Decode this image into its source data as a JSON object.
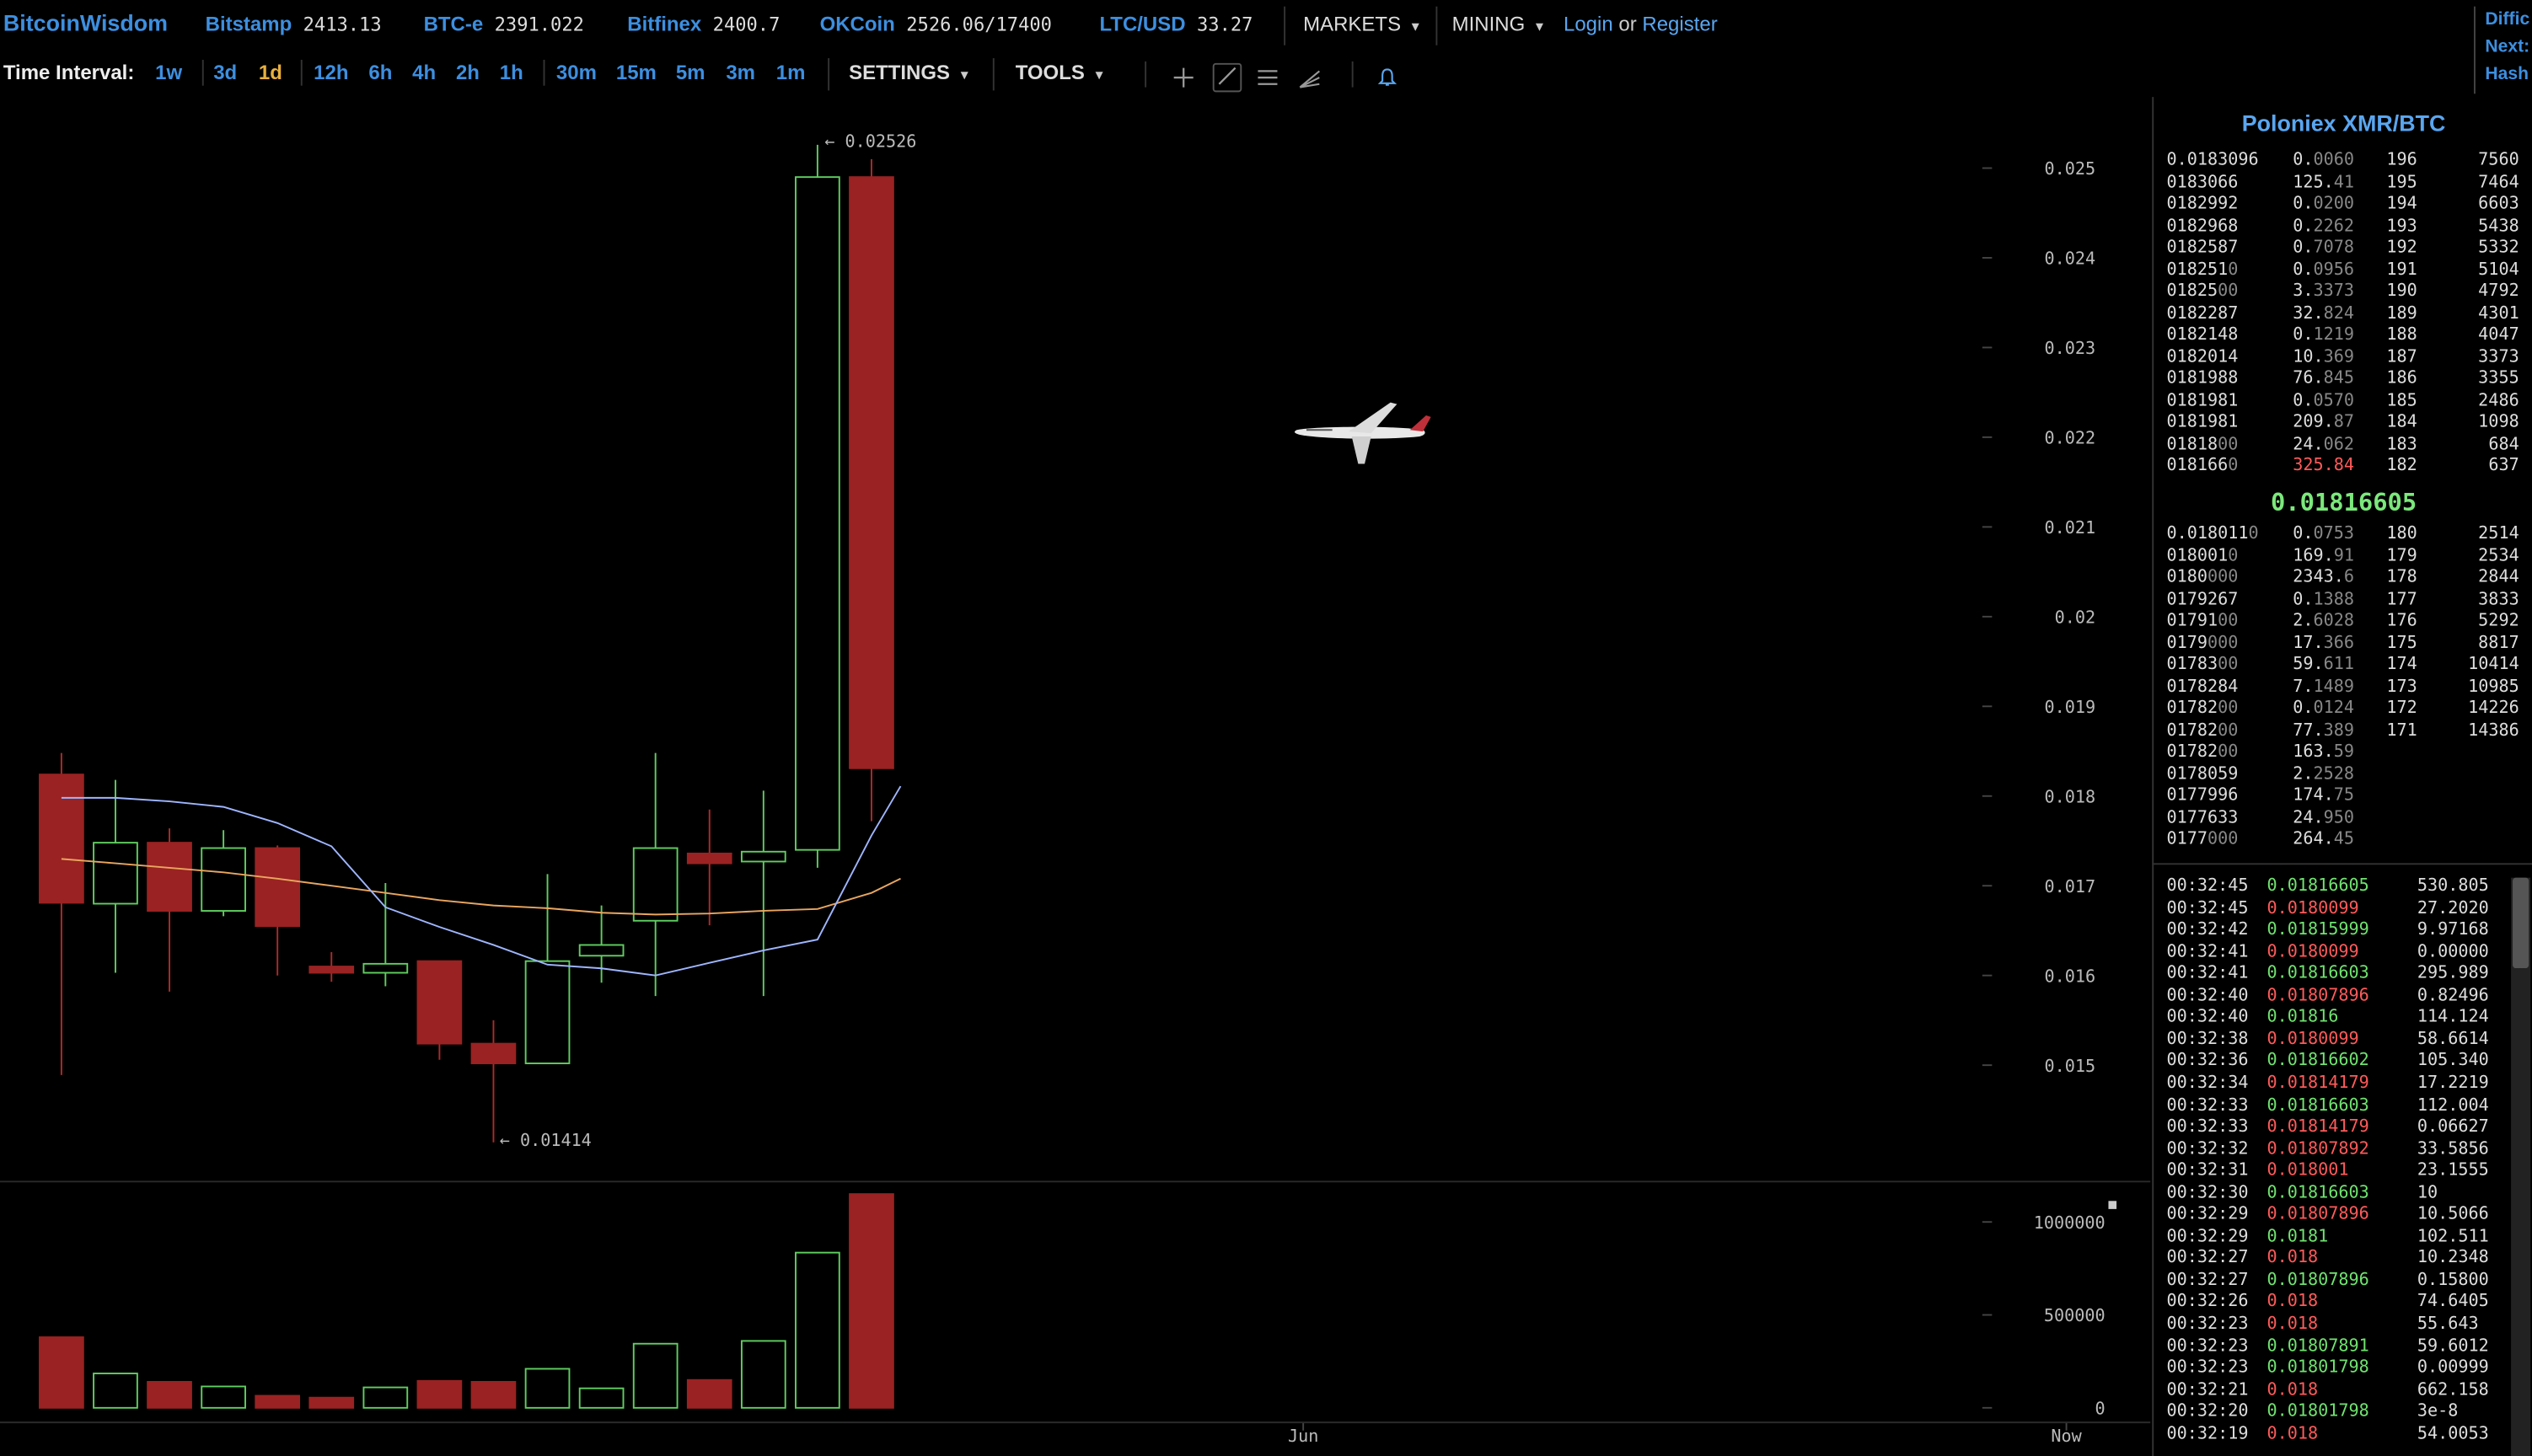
{
  "brand": "BitcoinWisdom",
  "tickers": [
    {
      "name": "Bitstamp",
      "value": "2413.13"
    },
    {
      "name": "BTC-e",
      "value": "2391.022"
    },
    {
      "name": "Bitfinex",
      "value": "2400.7"
    },
    {
      "name": "OKCoin",
      "value": "2526.06/17400"
    },
    {
      "name": "LTC/USD",
      "value": "33.27"
    }
  ],
  "menus": {
    "markets": "MARKETS",
    "mining": "MINING"
  },
  "auth": {
    "login": "Login",
    "or": "or",
    "register": "Register"
  },
  "corner": [
    "Diffic",
    "Next:",
    "Hash"
  ],
  "toolbar": {
    "time_interval_label": "Time Interval:",
    "intervals": [
      "1w",
      "3d",
      "1d",
      "12h",
      "6h",
      "4h",
      "2h",
      "1h",
      "30m",
      "15m",
      "5m",
      "3m",
      "1m"
    ],
    "active_interval": "1d",
    "settings": "SETTINGS",
    "tools": "TOOLS",
    "icons": [
      "crosshair-icon",
      "line-draw-icon",
      "fib-lines-icon",
      "fan-icon",
      "alert-bell-icon"
    ]
  },
  "chart_data": {
    "type": "candlestick",
    "price_axis": {
      "ticks": [
        "0.025",
        "0.024",
        "0.023",
        "0.022",
        "0.021",
        "0.02",
        "0.019",
        "0.018",
        "0.017",
        "0.016",
        "0.015"
      ],
      "range": [
        0.0142,
        0.0261
      ]
    },
    "volume_axis": {
      "ticks": [
        "1000000",
        "500000",
        "0"
      ],
      "range": [
        0,
        1160000
      ]
    },
    "time_axis": {
      "ticks": [
        "Jun",
        "Now"
      ]
    },
    "annotations": {
      "high": "← 0.02526",
      "low": "← 0.01414"
    },
    "candles": [
      {
        "open": 0.01824,
        "high": 0.01848,
        "low": 0.01489,
        "close": 0.01681,
        "volume": 380000
      },
      {
        "open": 0.0168,
        "high": 0.01818,
        "low": 0.01603,
        "close": 0.01748,
        "volume": 185000
      },
      {
        "open": 0.01748,
        "high": 0.01764,
        "low": 0.01582,
        "close": 0.01672,
        "volume": 140000
      },
      {
        "open": 0.01672,
        "high": 0.01762,
        "low": 0.01666,
        "close": 0.01742,
        "volume": 115000
      },
      {
        "open": 0.01742,
        "high": 0.01745,
        "low": 0.016,
        "close": 0.01655,
        "volume": 65000
      },
      {
        "open": 0.0161,
        "high": 0.01626,
        "low": 0.01593,
        "close": 0.01603,
        "volume": 55000
      },
      {
        "open": 0.01603,
        "high": 0.01703,
        "low": 0.01588,
        "close": 0.01613,
        "volume": 110000
      },
      {
        "open": 0.01616,
        "high": 0.01616,
        "low": 0.01506,
        "close": 0.01524,
        "volume": 145000
      },
      {
        "open": 0.01524,
        "high": 0.0155,
        "low": 0.01414,
        "close": 0.01502,
        "volume": 140000
      },
      {
        "open": 0.01502,
        "high": 0.01713,
        "low": 0.01502,
        "close": 0.01616,
        "volume": 210000
      },
      {
        "open": 0.01622,
        "high": 0.01678,
        "low": 0.01592,
        "close": 0.01634,
        "volume": 105000
      },
      {
        "open": 0.01661,
        "high": 0.01848,
        "low": 0.01577,
        "close": 0.01742,
        "volume": 345000
      },
      {
        "open": 0.01736,
        "high": 0.01785,
        "low": 0.01656,
        "close": 0.01725,
        "volume": 150000
      },
      {
        "open": 0.01727,
        "high": 0.01806,
        "low": 0.01577,
        "close": 0.01738,
        "volume": 360000
      },
      {
        "open": 0.0174,
        "high": 0.02526,
        "low": 0.0172,
        "close": 0.0249,
        "volume": 835000
      },
      {
        "open": 0.0249,
        "high": 0.0251,
        "low": 0.01772,
        "close": 0.01831,
        "volume": 1150000
      }
    ],
    "sma_fast": [
      0.01798,
      0.01798,
      0.01794,
      0.01788,
      0.0177,
      0.01744,
      0.01676,
      0.01654,
      0.01634,
      0.01612,
      0.01608,
      0.016,
      0.01614,
      0.01628,
      0.0164,
      0.01756,
      0.01811
    ],
    "sma_slow": [
      0.0173,
      0.01725,
      0.0172,
      0.01715,
      0.01708,
      0.017,
      0.01692,
      0.01684,
      0.01678,
      0.01675,
      0.0167,
      0.01668,
      0.01669,
      0.01672,
      0.01674,
      0.01692,
      0.01708
    ]
  },
  "panel": {
    "title": "Poloniex XMR/BTC",
    "asks": [
      {
        "p1": "0.0183096",
        "p2": "",
        "amount": "0.0060",
        "depth": "196",
        "total": "7560"
      },
      {
        "p1": "0183066",
        "p2": "",
        "amount": "125.41",
        "depth": "195",
        "total": "7464"
      },
      {
        "p1": "0182992",
        "p2": "",
        "amount": "0.0200",
        "depth": "194",
        "total": "6603"
      },
      {
        "p1": "0182968",
        "p2": "",
        "amount": "0.2262",
        "depth": "193",
        "total": "5438"
      },
      {
        "p1": "0182587",
        "p2": "",
        "amount": "0.7078",
        "depth": "192",
        "total": "5332"
      },
      {
        "p1": "018251",
        "p2": "0",
        "amount": "0.0956",
        "depth": "191",
        "total": "5104"
      },
      {
        "p1": "01825",
        "p2": "00",
        "amount": "3.3373",
        "depth": "190",
        "total": "4792"
      },
      {
        "p1": "0182287",
        "p2": "",
        "amount": "32.824",
        "depth": "189",
        "total": "4301"
      },
      {
        "p1": "0182148",
        "p2": "",
        "amount": "0.1219",
        "depth": "188",
        "total": "4047"
      },
      {
        "p1": "0182014",
        "p2": "",
        "amount": "10.369",
        "depth": "187",
        "total": "3373"
      },
      {
        "p1": "0181988",
        "p2": "",
        "amount": "76.845",
        "depth": "186",
        "total": "3355"
      },
      {
        "p1": "0181981",
        "p2": "",
        "amount": "0.0570",
        "depth": "185",
        "total": "2486"
      },
      {
        "p1": "0181981",
        "p2": "",
        "amount": "209.87",
        "depth": "184",
        "total": "1098"
      },
      {
        "p1": "01818",
        "p2": "00",
        "amount": "24.062",
        "depth": "183",
        "total": "684"
      },
      {
        "p1": "018166",
        "p2": "0",
        "amount": "325.84",
        "depth": "182",
        "total": "637"
      }
    ],
    "last_price": "0.01816605",
    "bids": [
      {
        "p1": "0.018011",
        "p2": "0",
        "amount": "0.0753",
        "depth": "180",
        "total": "2514"
      },
      {
        "p1": "018001",
        "p2": "0",
        "amount": "169.91",
        "depth": "179",
        "total": "2534"
      },
      {
        "p1": "0180",
        "p2": "000",
        "amount": "2343.6",
        "depth": "178",
        "total": "2844"
      },
      {
        "p1": "0179267",
        "p2": "",
        "amount": "0.1388",
        "depth": "177",
        "total": "3833"
      },
      {
        "p1": "01791",
        "p2": "00",
        "amount": "2.6028",
        "depth": "176",
        "total": "5292"
      },
      {
        "p1": "0179",
        "p2": "000",
        "amount": "17.366",
        "depth": "175",
        "total": "8817"
      },
      {
        "p1": "01783",
        "p2": "00",
        "amount": "59.611",
        "depth": "174",
        "total": "10414"
      },
      {
        "p1": "0178284",
        "p2": "",
        "amount": "7.1489",
        "depth": "173",
        "total": "10985"
      },
      {
        "p1": "01782",
        "p2": "00",
        "amount": "0.0124",
        "depth": "172",
        "total": "14226"
      },
      {
        "p1": "01782",
        "p2": "00",
        "amount": "77.389",
        "depth": "171",
        "total": "14386"
      },
      {
        "p1": "01782",
        "p2": "00",
        "amount": "163.59",
        "depth": "",
        "total": ""
      },
      {
        "p1": "0178059",
        "p2": "",
        "amount": "2.2528",
        "depth": "",
        "total": ""
      },
      {
        "p1": "0177996",
        "p2": "",
        "amount": "174.75",
        "depth": "",
        "total": ""
      },
      {
        "p1": "0177633",
        "p2": "",
        "amount": "24.950",
        "depth": "",
        "total": ""
      },
      {
        "p1": "0177",
        "p2": "000",
        "amount": "264.45",
        "depth": "",
        "total": ""
      }
    ],
    "trades": [
      {
        "time": "00:32:45",
        "price": "0.01816605",
        "side": "buy",
        "amount": "530.805"
      },
      {
        "time": "00:32:45",
        "price": "0.0180099",
        "side": "sell",
        "amount": "27.2020"
      },
      {
        "time": "00:32:42",
        "price": "0.01815999",
        "side": "buy",
        "amount": "9.97168"
      },
      {
        "time": "00:32:41",
        "price": "0.0180099",
        "side": "sell",
        "amount": "0.00000"
      },
      {
        "time": "00:32:41",
        "price": "0.01816603",
        "side": "buy",
        "amount": "295.989"
      },
      {
        "time": "00:32:40",
        "price": "0.01807896",
        "side": "sell",
        "amount": "0.82496"
      },
      {
        "time": "00:32:40",
        "price": "0.01816",
        "side": "buy",
        "amount": "114.124"
      },
      {
        "time": "00:32:38",
        "price": "0.0180099",
        "side": "sell",
        "amount": "58.6614"
      },
      {
        "time": "00:32:36",
        "price": "0.01816602",
        "side": "buy",
        "amount": "105.340"
      },
      {
        "time": "00:32:34",
        "price": "0.01814179",
        "side": "sell",
        "amount": "17.2219"
      },
      {
        "time": "00:32:33",
        "price": "0.01816603",
        "side": "buy",
        "amount": "112.004"
      },
      {
        "time": "00:32:33",
        "price": "0.01814179",
        "side": "sell",
        "amount": "0.06627"
      },
      {
        "time": "00:32:32",
        "price": "0.01807892",
        "side": "sell",
        "amount": "33.5856"
      },
      {
        "time": "00:32:31",
        "price": "0.018001",
        "side": "sell",
        "amount": "23.1555"
      },
      {
        "time": "00:32:30",
        "price": "0.01816603",
        "side": "buy",
        "amount": "10"
      },
      {
        "time": "00:32:29",
        "price": "0.01807896",
        "side": "sell",
        "amount": "10.5066"
      },
      {
        "time": "00:32:29",
        "price": "0.0181",
        "side": "buy",
        "amount": "102.511"
      },
      {
        "time": "00:32:27",
        "price": "0.018",
        "side": "sell",
        "amount": "10.2348"
      },
      {
        "time": "00:32:27",
        "price": "0.01807896",
        "side": "buy",
        "amount": "0.15800"
      },
      {
        "time": "00:32:26",
        "price": "0.018",
        "side": "sell",
        "amount": "74.6405"
      },
      {
        "time": "00:32:23",
        "price": "0.018",
        "side": "sell",
        "amount": "55.643"
      },
      {
        "time": "00:32:23",
        "price": "0.01807891",
        "side": "buy",
        "amount": "59.6012"
      },
      {
        "time": "00:32:23",
        "price": "0.01801798",
        "side": "buy",
        "amount": "0.00999"
      },
      {
        "time": "00:32:21",
        "price": "0.018",
        "side": "sell",
        "amount": "662.158"
      },
      {
        "time": "00:32:20",
        "price": "0.01801798",
        "side": "buy",
        "amount": "3e-8"
      },
      {
        "time": "00:32:19",
        "price": "0.018",
        "side": "sell",
        "amount": "54.0053"
      }
    ]
  },
  "colors": {
    "up": "#5fce5f",
    "down": "#9a2222",
    "sma_fast": "#9fb6ff",
    "sma_slow": "#e9a660",
    "link": "#3d8fe0",
    "active": "#e8b03c"
  }
}
